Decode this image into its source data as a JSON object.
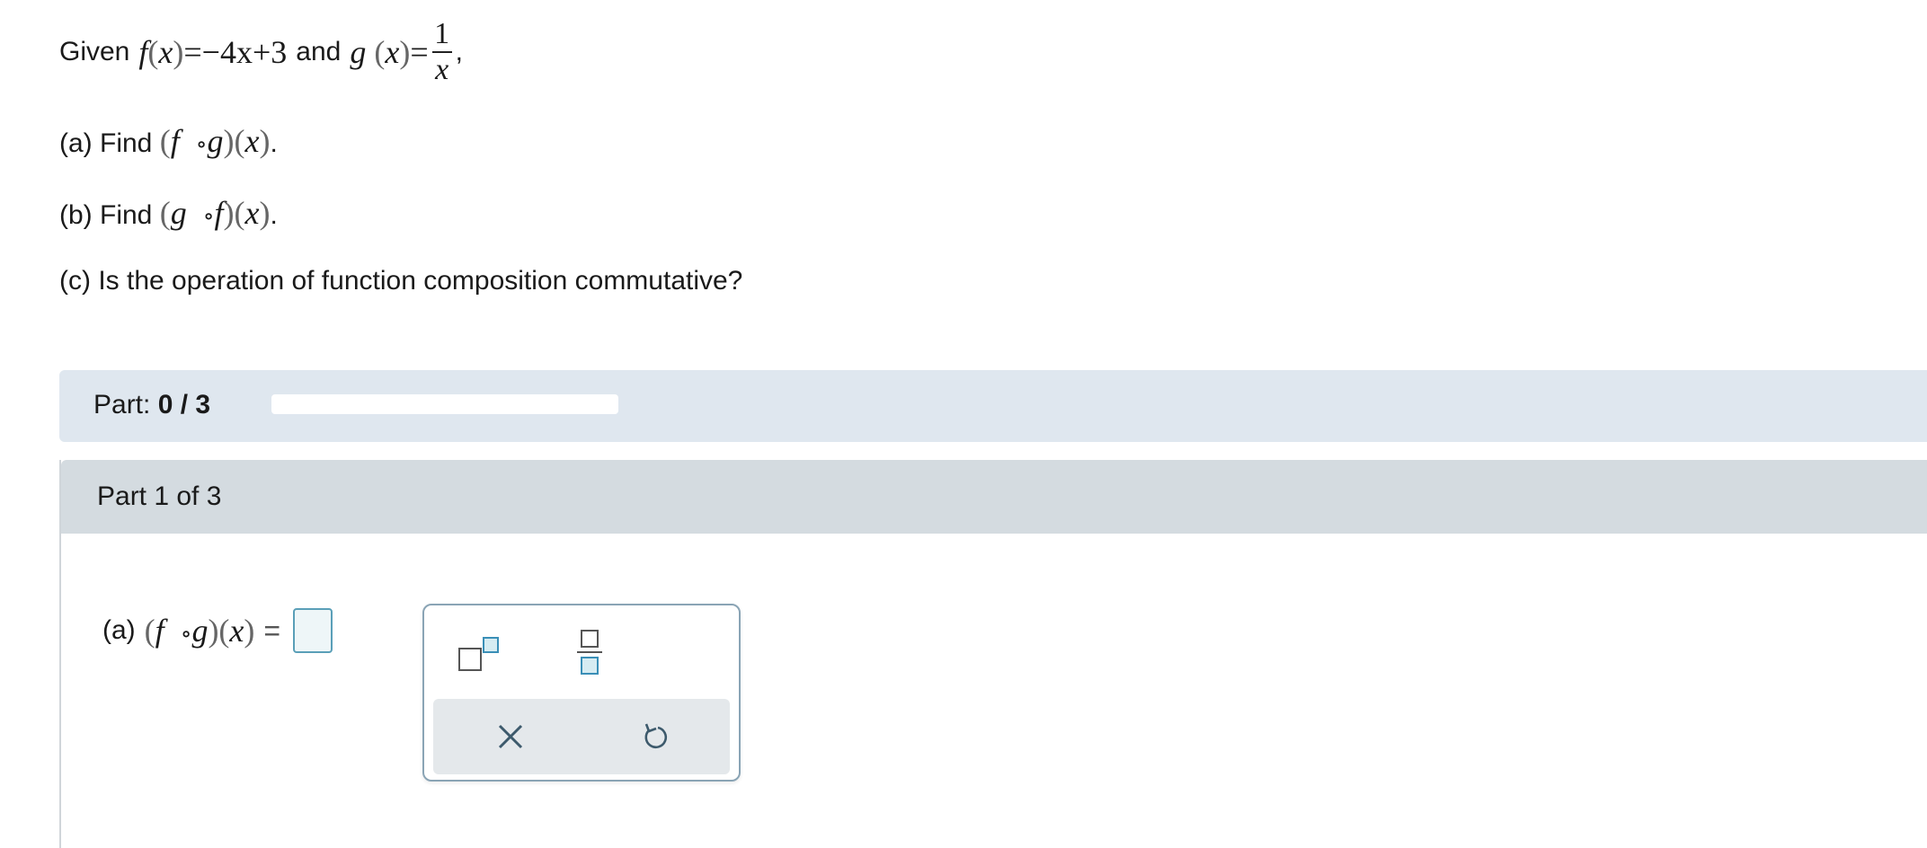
{
  "question": {
    "given_word": "Given",
    "f_def": {
      "name": "f",
      "var": "x",
      "rhs": "=−4x+3"
    },
    "and_word": "and",
    "g_def": {
      "name": "g",
      "var": "x",
      "eq": "=",
      "num": "1",
      "den": "x"
    },
    "trailing_comma": ",",
    "part_a": {
      "prefix": "(a) Find",
      "outer": "f",
      "op": "∘",
      "inner": "g",
      "var": "x",
      "suffix": "."
    },
    "part_b": {
      "prefix": "(b) Find",
      "outer": "g",
      "op": "∘",
      "inner": "f",
      "var": "x",
      "suffix": "."
    },
    "part_c": "(c) Is the operation of function composition commutative?"
  },
  "progress": {
    "label": "Part:",
    "value_text": "0 / 3",
    "fraction": 0
  },
  "current_part": {
    "header": "Part 1 of 3",
    "answer_label": "(a)",
    "outer": "f",
    "op": "∘",
    "inner": "g",
    "var": "x",
    "equals": "="
  },
  "palette": {
    "buttons": [
      "superscript-icon",
      "fraction-icon",
      "clear-icon",
      "undo-icon"
    ]
  },
  "colors": {
    "accent": "#3a8fb7",
    "progress_bg": "#dfe7ef",
    "header_bg": "#d4dbe0",
    "answer_box_bg": "#eef6f8"
  }
}
